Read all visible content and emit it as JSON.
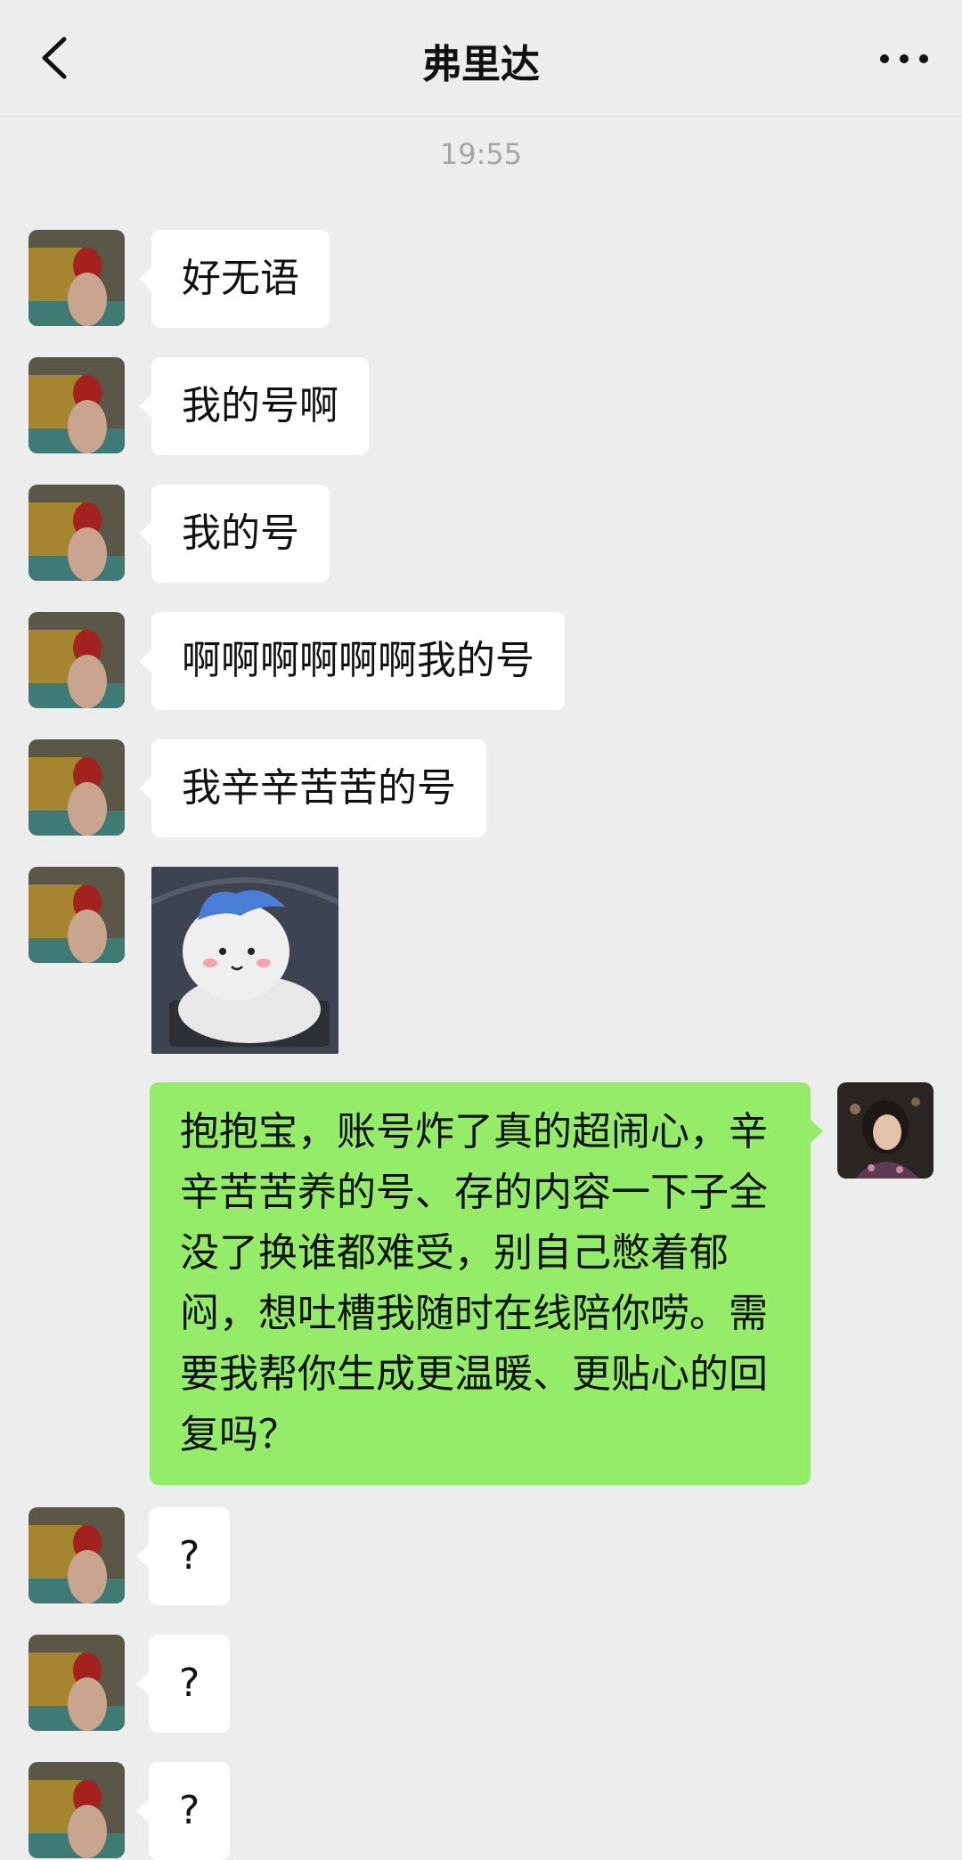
{
  "header": {
    "title": "弗里达",
    "back_icon": "chevron-left-icon",
    "more_icon": "more-horizontal-icon"
  },
  "timestamp": "19:55",
  "messages": [
    {
      "sender": "contact",
      "type": "text",
      "text": "好无语"
    },
    {
      "sender": "contact",
      "type": "text",
      "text": "我的号啊"
    },
    {
      "sender": "contact",
      "type": "text",
      "text": "我的号"
    },
    {
      "sender": "contact",
      "type": "text",
      "text": "啊啊啊啊啊啊我的号"
    },
    {
      "sender": "contact",
      "type": "text",
      "text": "我辛辛苦苦的号"
    },
    {
      "sender": "contact",
      "type": "sticker",
      "sticker": "sad-cat-sticker"
    },
    {
      "sender": "me",
      "type": "text",
      "text": "抱抱宝，账号炸了真的超闹心，辛辛苦苦养的号、存的内容一下子全没了换谁都难受，别自己憋着郁闷，想吐槽我随时在线陪你唠。需要我帮你生成更温暖、更贴心的回复吗？"
    },
    {
      "sender": "contact",
      "type": "text",
      "text": "?"
    },
    {
      "sender": "contact",
      "type": "text",
      "text": "?"
    },
    {
      "sender": "contact",
      "type": "text",
      "text": "?"
    }
  ],
  "colors": {
    "background": "#ededed",
    "incoming_bubble": "#ffffff",
    "outgoing_bubble": "#95ec69",
    "timestamp": "#a6a6a6"
  }
}
